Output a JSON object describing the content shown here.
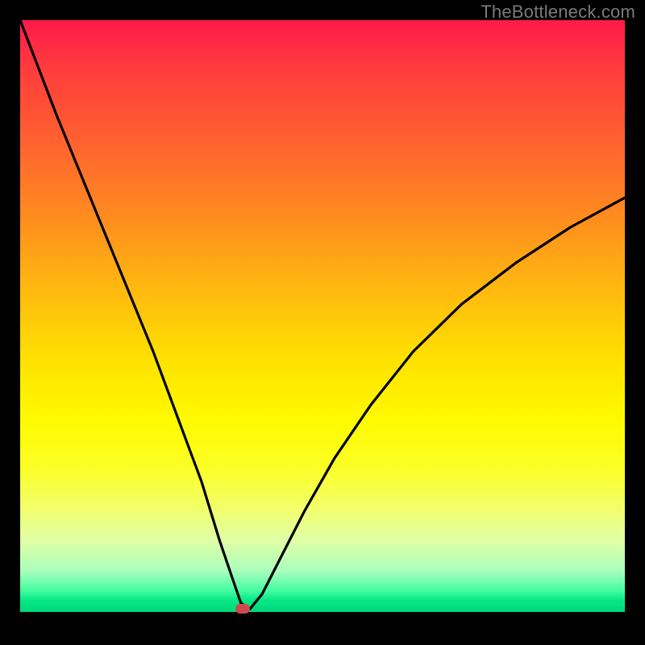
{
  "watermark": "TheBottleneck.com",
  "chart_data": {
    "type": "line",
    "title": "",
    "xlabel": "",
    "ylabel": "",
    "xlim": [
      0,
      100
    ],
    "ylim": [
      0,
      100
    ],
    "grid": false,
    "background": {
      "type": "vertical-gradient",
      "stops": [
        {
          "pos": 0.0,
          "color": "#ff1a49"
        },
        {
          "pos": 0.2,
          "color": "#ff6030"
        },
        {
          "pos": 0.45,
          "color": "#ffb710"
        },
        {
          "pos": 0.68,
          "color": "#fffb00"
        },
        {
          "pos": 0.88,
          "color": "#e0ffa7"
        },
        {
          "pos": 1.0,
          "color": "#00db7c"
        }
      ]
    },
    "series": [
      {
        "name": "bottleneck-curve",
        "color": "#000000",
        "x": [
          0,
          3,
          6,
          10,
          14,
          18,
          22,
          26,
          30,
          33,
          35,
          36.5,
          38,
          40,
          43,
          47,
          52,
          58,
          65,
          73,
          82,
          91,
          100
        ],
        "y": [
          100,
          92,
          84,
          74,
          64,
          54,
          44,
          33,
          22,
          12,
          6,
          1.5,
          0.5,
          3,
          9,
          17,
          26,
          35,
          44,
          52,
          59,
          65,
          70
        ]
      }
    ],
    "marker": {
      "name": "minimum-point",
      "x": 36.8,
      "y": 0.5,
      "color": "#cd4b4b"
    }
  },
  "colors": {
    "frame": "#000000",
    "curve": "#000000",
    "marker": "#cd4b4b",
    "watermark": "#7a7a7a"
  }
}
